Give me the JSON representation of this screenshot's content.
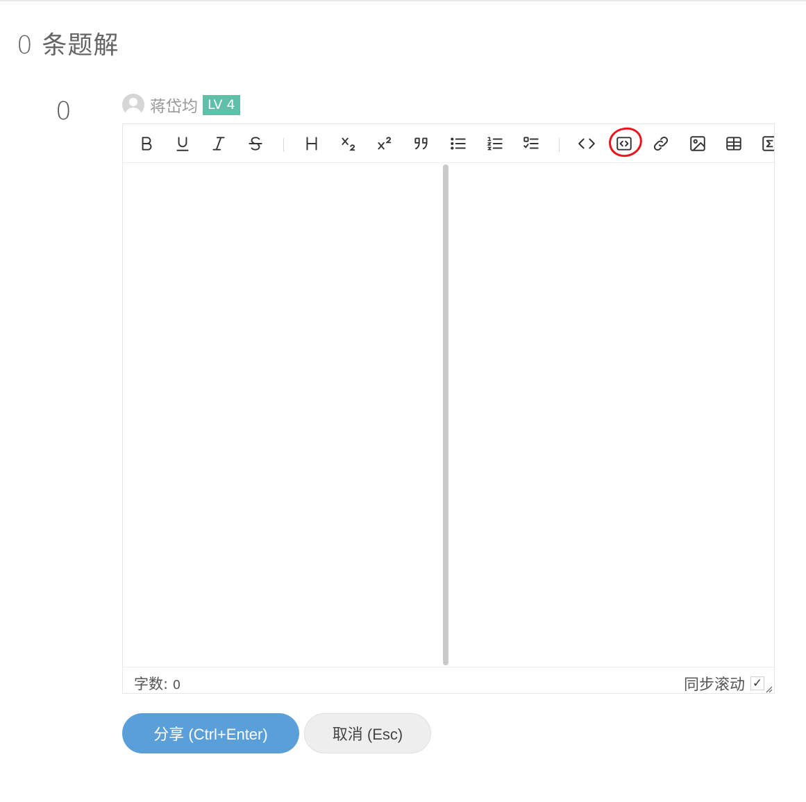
{
  "header": {
    "solutions_title": "0 条题解"
  },
  "vote": {
    "count": "0"
  },
  "user": {
    "name": "蒋岱均",
    "level": "LV 4"
  },
  "toolbar": {
    "buttons": [
      {
        "name": "bold",
        "icon": "bold-icon"
      },
      {
        "name": "underline",
        "icon": "underline-icon"
      },
      {
        "name": "italic",
        "icon": "italic-icon"
      },
      {
        "name": "strikethrough",
        "icon": "strikethrough-icon"
      },
      {
        "name": "heading",
        "icon": "heading-icon"
      },
      {
        "name": "subscript",
        "icon": "subscript-icon"
      },
      {
        "name": "superscript",
        "icon": "superscript-icon"
      },
      {
        "name": "quote",
        "icon": "quote-icon"
      },
      {
        "name": "unordered-list",
        "icon": "unordered-list-icon"
      },
      {
        "name": "ordered-list",
        "icon": "ordered-list-icon"
      },
      {
        "name": "task-list",
        "icon": "task-list-icon"
      },
      {
        "name": "inline-code",
        "icon": "code-icon"
      },
      {
        "name": "code-block",
        "icon": "code-block-icon"
      },
      {
        "name": "link",
        "icon": "link-icon"
      },
      {
        "name": "image",
        "icon": "image-icon"
      },
      {
        "name": "table",
        "icon": "table-icon"
      },
      {
        "name": "formula",
        "icon": "sigma-icon"
      }
    ],
    "highlighted": "code-block",
    "highlight_color": "#e8141e"
  },
  "editor": {
    "content": "",
    "preview": ""
  },
  "status": {
    "word_count_label": "字数:",
    "word_count_value": "0",
    "sync_scroll_label": "同步滚动",
    "sync_scroll_checked": "✓"
  },
  "actions": {
    "share_label": "分享 (Ctrl+Enter)",
    "cancel_label": "取消 (Esc)"
  },
  "colors": {
    "accent": "#5a9fd8",
    "badge": "#5fbfa9"
  }
}
